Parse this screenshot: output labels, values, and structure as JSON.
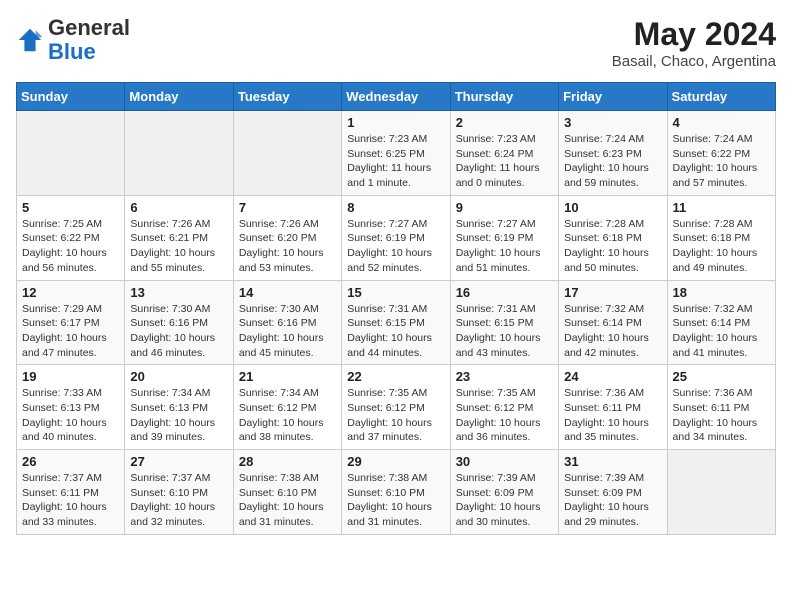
{
  "header": {
    "logo_general": "General",
    "logo_blue": "Blue",
    "month_year": "May 2024",
    "location": "Basail, Chaco, Argentina"
  },
  "weekdays": [
    "Sunday",
    "Monday",
    "Tuesday",
    "Wednesday",
    "Thursday",
    "Friday",
    "Saturday"
  ],
  "weeks": [
    [
      {
        "day": "",
        "info": ""
      },
      {
        "day": "",
        "info": ""
      },
      {
        "day": "",
        "info": ""
      },
      {
        "day": "1",
        "info": "Sunrise: 7:23 AM\nSunset: 6:25 PM\nDaylight: 11 hours\nand 1 minute."
      },
      {
        "day": "2",
        "info": "Sunrise: 7:23 AM\nSunset: 6:24 PM\nDaylight: 11 hours\nand 0 minutes."
      },
      {
        "day": "3",
        "info": "Sunrise: 7:24 AM\nSunset: 6:23 PM\nDaylight: 10 hours\nand 59 minutes."
      },
      {
        "day": "4",
        "info": "Sunrise: 7:24 AM\nSunset: 6:22 PM\nDaylight: 10 hours\nand 57 minutes."
      }
    ],
    [
      {
        "day": "5",
        "info": "Sunrise: 7:25 AM\nSunset: 6:22 PM\nDaylight: 10 hours\nand 56 minutes."
      },
      {
        "day": "6",
        "info": "Sunrise: 7:26 AM\nSunset: 6:21 PM\nDaylight: 10 hours\nand 55 minutes."
      },
      {
        "day": "7",
        "info": "Sunrise: 7:26 AM\nSunset: 6:20 PM\nDaylight: 10 hours\nand 53 minutes."
      },
      {
        "day": "8",
        "info": "Sunrise: 7:27 AM\nSunset: 6:19 PM\nDaylight: 10 hours\nand 52 minutes."
      },
      {
        "day": "9",
        "info": "Sunrise: 7:27 AM\nSunset: 6:19 PM\nDaylight: 10 hours\nand 51 minutes."
      },
      {
        "day": "10",
        "info": "Sunrise: 7:28 AM\nSunset: 6:18 PM\nDaylight: 10 hours\nand 50 minutes."
      },
      {
        "day": "11",
        "info": "Sunrise: 7:28 AM\nSunset: 6:18 PM\nDaylight: 10 hours\nand 49 minutes."
      }
    ],
    [
      {
        "day": "12",
        "info": "Sunrise: 7:29 AM\nSunset: 6:17 PM\nDaylight: 10 hours\nand 47 minutes."
      },
      {
        "day": "13",
        "info": "Sunrise: 7:30 AM\nSunset: 6:16 PM\nDaylight: 10 hours\nand 46 minutes."
      },
      {
        "day": "14",
        "info": "Sunrise: 7:30 AM\nSunset: 6:16 PM\nDaylight: 10 hours\nand 45 minutes."
      },
      {
        "day": "15",
        "info": "Sunrise: 7:31 AM\nSunset: 6:15 PM\nDaylight: 10 hours\nand 44 minutes."
      },
      {
        "day": "16",
        "info": "Sunrise: 7:31 AM\nSunset: 6:15 PM\nDaylight: 10 hours\nand 43 minutes."
      },
      {
        "day": "17",
        "info": "Sunrise: 7:32 AM\nSunset: 6:14 PM\nDaylight: 10 hours\nand 42 minutes."
      },
      {
        "day": "18",
        "info": "Sunrise: 7:32 AM\nSunset: 6:14 PM\nDaylight: 10 hours\nand 41 minutes."
      }
    ],
    [
      {
        "day": "19",
        "info": "Sunrise: 7:33 AM\nSunset: 6:13 PM\nDaylight: 10 hours\nand 40 minutes."
      },
      {
        "day": "20",
        "info": "Sunrise: 7:34 AM\nSunset: 6:13 PM\nDaylight: 10 hours\nand 39 minutes."
      },
      {
        "day": "21",
        "info": "Sunrise: 7:34 AM\nSunset: 6:12 PM\nDaylight: 10 hours\nand 38 minutes."
      },
      {
        "day": "22",
        "info": "Sunrise: 7:35 AM\nSunset: 6:12 PM\nDaylight: 10 hours\nand 37 minutes."
      },
      {
        "day": "23",
        "info": "Sunrise: 7:35 AM\nSunset: 6:12 PM\nDaylight: 10 hours\nand 36 minutes."
      },
      {
        "day": "24",
        "info": "Sunrise: 7:36 AM\nSunset: 6:11 PM\nDaylight: 10 hours\nand 35 minutes."
      },
      {
        "day": "25",
        "info": "Sunrise: 7:36 AM\nSunset: 6:11 PM\nDaylight: 10 hours\nand 34 minutes."
      }
    ],
    [
      {
        "day": "26",
        "info": "Sunrise: 7:37 AM\nSunset: 6:11 PM\nDaylight: 10 hours\nand 33 minutes."
      },
      {
        "day": "27",
        "info": "Sunrise: 7:37 AM\nSunset: 6:10 PM\nDaylight: 10 hours\nand 32 minutes."
      },
      {
        "day": "28",
        "info": "Sunrise: 7:38 AM\nSunset: 6:10 PM\nDaylight: 10 hours\nand 31 minutes."
      },
      {
        "day": "29",
        "info": "Sunrise: 7:38 AM\nSunset: 6:10 PM\nDaylight: 10 hours\nand 31 minutes."
      },
      {
        "day": "30",
        "info": "Sunrise: 7:39 AM\nSunset: 6:09 PM\nDaylight: 10 hours\nand 30 minutes."
      },
      {
        "day": "31",
        "info": "Sunrise: 7:39 AM\nSunset: 6:09 PM\nDaylight: 10 hours\nand 29 minutes."
      },
      {
        "day": "",
        "info": ""
      }
    ]
  ]
}
